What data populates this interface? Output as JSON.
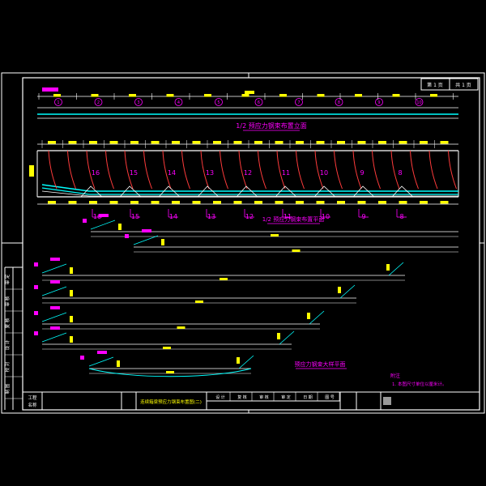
{
  "drawing": {
    "elevation_title": "1/2 预应力钢束布置立面",
    "plan_title": "1/2 预应力钢束布置平面",
    "detail_title": "预应力钢束大样平面",
    "note_heading": "附注",
    "note_text": "1. 本图尺寸单位以厘米计。",
    "section_marks": [
      "16",
      "15",
      "14",
      "13",
      "12",
      "11",
      "10",
      "9",
      "8"
    ],
    "top_circle_marks": [
      "1",
      "2",
      "3",
      "4",
      "5",
      "6",
      "7",
      "8",
      "9",
      "10"
    ]
  },
  "title_block": {
    "sheet_no": "第 1 页",
    "sheet_total": "共 1 页",
    "drawing_name": "连续箱梁预应力钢束布置图(二)",
    "left_labels": [
      "工程",
      "名称"
    ],
    "cells": [
      "设 计",
      "复 核",
      "审 核",
      "审 定",
      "日 期",
      "图 号"
    ],
    "side_labels": [
      "审 定",
      "审 核",
      "复 核",
      "设 计",
      "校 对",
      "制 图"
    ]
  },
  "colors": {
    "frame": "#ffffff",
    "beam": "#00ffff",
    "tendon": "#ff3b3b",
    "dimension": "#ffff00",
    "label": "#ff00ff"
  }
}
